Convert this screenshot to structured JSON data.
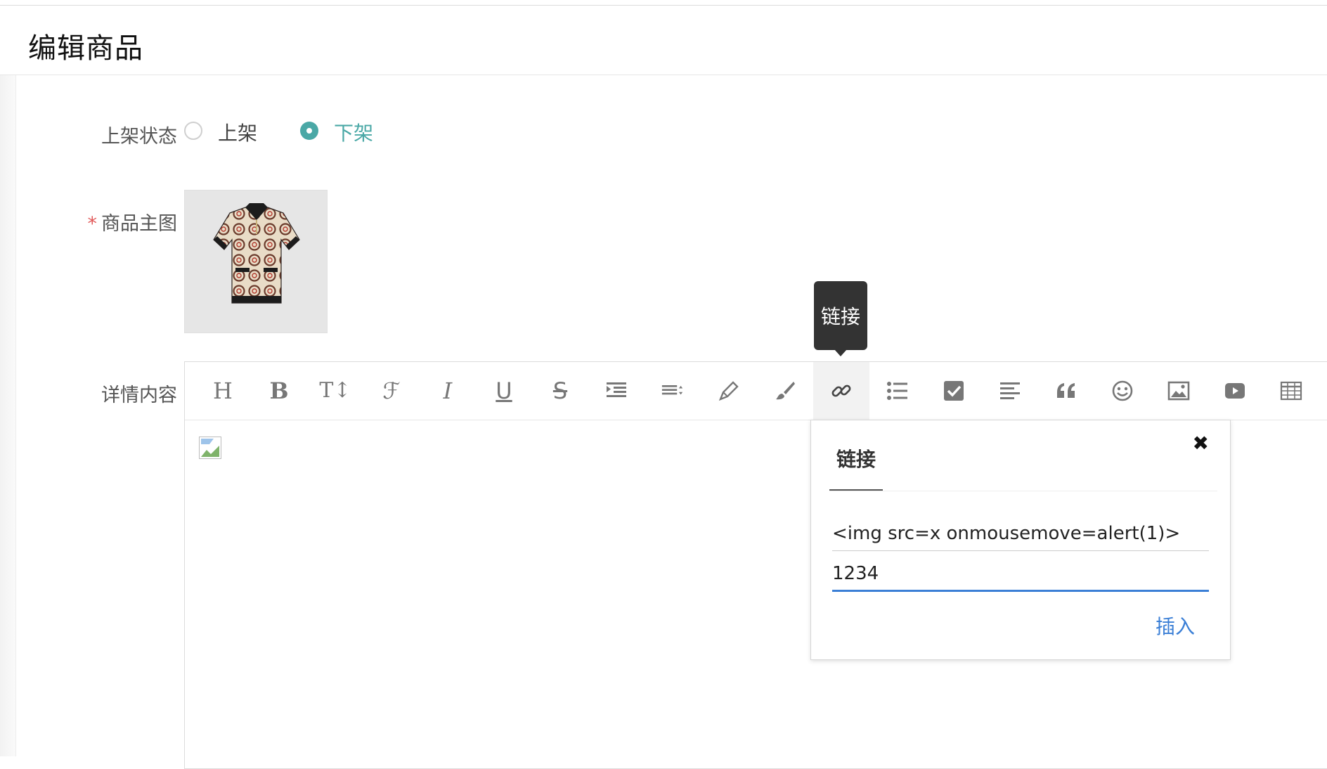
{
  "page": {
    "title": "编辑商品"
  },
  "form": {
    "status": {
      "label": "上架状态",
      "options": [
        {
          "label": "上架",
          "checked": false
        },
        {
          "label": "下架",
          "checked": true
        }
      ]
    },
    "main_image": {
      "required_mark": "*",
      "label": "商品主图",
      "image": "polo-dress-thumbnail"
    },
    "detail": {
      "label": "详情内容"
    }
  },
  "editor": {
    "toolbar": [
      {
        "name": "head",
        "icon": "heading-icon",
        "glyph": "H"
      },
      {
        "name": "bold",
        "icon": "bold-icon",
        "glyph": "B"
      },
      {
        "name": "font-size",
        "icon": "font-size-icon",
        "glyph": "T↕"
      },
      {
        "name": "font-name",
        "icon": "font-family-icon",
        "glyph": "ℱ"
      },
      {
        "name": "italic",
        "icon": "italic-icon",
        "glyph": "I"
      },
      {
        "name": "underline",
        "icon": "underline-icon",
        "glyph": "U"
      },
      {
        "name": "strike",
        "icon": "strikethrough-icon",
        "glyph": "S"
      },
      {
        "name": "indent",
        "icon": "indent-icon",
        "glyph": ""
      },
      {
        "name": "line-height",
        "icon": "line-height-icon",
        "glyph": ""
      },
      {
        "name": "fore-color",
        "icon": "pencil-icon",
        "glyph": ""
      },
      {
        "name": "back-color",
        "icon": "paint-brush-icon",
        "glyph": ""
      },
      {
        "name": "link",
        "icon": "link-icon",
        "glyph": "",
        "active": true
      },
      {
        "name": "list",
        "icon": "list-icon",
        "glyph": ""
      },
      {
        "name": "todo",
        "icon": "checkbox-icon",
        "glyph": ""
      },
      {
        "name": "justify",
        "icon": "align-left-icon",
        "glyph": ""
      },
      {
        "name": "quote",
        "icon": "quote-icon",
        "glyph": "“"
      },
      {
        "name": "emoticon",
        "icon": "smiley-icon",
        "glyph": ""
      },
      {
        "name": "image",
        "icon": "image-icon",
        "glyph": ""
      },
      {
        "name": "video",
        "icon": "video-icon",
        "glyph": ""
      },
      {
        "name": "table",
        "icon": "table-icon",
        "glyph": ""
      }
    ],
    "tooltip": "链接",
    "content": {
      "broken_image": "broken-image-icon"
    },
    "link_panel": {
      "tab": "链接",
      "close": "✖",
      "text_value": "<img src=x onmousemove=alert(1)>",
      "url_value": "1234",
      "insert_label": "插入"
    }
  }
}
